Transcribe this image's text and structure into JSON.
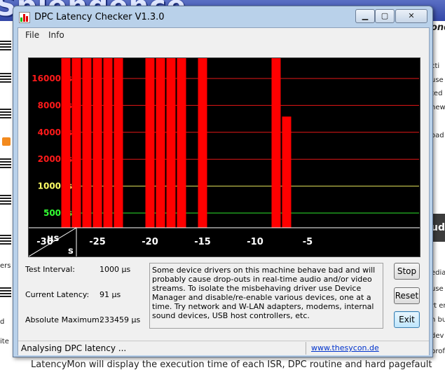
{
  "background": {
    "banner_text": "Splendence",
    "left_fragments": [
      "ers",
      "d",
      "ite"
    ],
    "right_fragments": [
      "ond",
      "cti",
      "use",
      "ted",
      "new",
      "oad",
      "udi",
      "edia",
      "use",
      "rt en",
      "n bui",
      "dev",
      "profe"
    ],
    "bottom_text": "LatencyMon will display the execution time of each ISR, DPC routine and hard pagefault"
  },
  "window": {
    "title": "DPC Latency Checker V1.3.0",
    "minimize_glyph": "▁",
    "maximize_glyph": "▢",
    "close_glyph": "✕"
  },
  "menu": {
    "items": [
      "File",
      "Info"
    ]
  },
  "chart_data": {
    "type": "bar",
    "title": "",
    "xlabel": "s",
    "ylabel": "µs",
    "x_ticks": [
      "-30",
      "-25",
      "-20",
      "-15",
      "-10",
      "-5"
    ],
    "y_ticks": [
      {
        "label": "16000µs",
        "value": 16000,
        "color": "#ff1a1a"
      },
      {
        "label": "8000µs",
        "value": 8000,
        "color": "#ff1a1a"
      },
      {
        "label": "4000µs",
        "value": 4000,
        "color": "#ff1a1a"
      },
      {
        "label": "2000µs",
        "value": 2000,
        "color": "#ff1a1a"
      },
      {
        "label": "1000µs",
        "value": 1000,
        "color": "#ffff66"
      },
      {
        "label": "500µs",
        "value": 500,
        "color": "#33ff33"
      }
    ],
    "x": [
      -33,
      -32,
      -31,
      -30,
      -29,
      -28,
      -27,
      -26,
      -25,
      -24,
      -23,
      -22,
      -21,
      -20,
      -19,
      -18,
      -17,
      -16,
      -15,
      -14,
      -13,
      -12,
      -11,
      -10,
      -9,
      -8,
      -7,
      -6,
      -5,
      -4,
      -3,
      -2,
      -1,
      0
    ],
    "values": [
      95,
      130,
      140,
      105,
      150,
      233459,
      233459,
      233459,
      233459,
      233459,
      233459,
      80,
      110,
      233459,
      233459,
      233459,
      233459,
      140,
      233459,
      150,
      145,
      140,
      130,
      125,
      150,
      233459,
      6000,
      100,
      85,
      110,
      100,
      115,
      120,
      140
    ],
    "ylim": [
      0,
      32000
    ],
    "colors": {
      "low": "#00ff00",
      "high": "#ff0000"
    }
  },
  "stats": {
    "test_interval_label": "Test Interval:",
    "test_interval_value": "1000 µs",
    "current_latency_label": "Current Latency:",
    "current_latency_value": "91 µs",
    "absolute_maximum_label": "Absolute Maximum:",
    "absolute_maximum_value": "233459 µs"
  },
  "description": "Some device drivers on this machine behave bad and will probably cause drop-outs in real-time audio and/or video streams. To isolate the misbehaving driver use Device Manager and disable/re-enable various devices, one at a time. Try network and W-LAN adapters, modems, internal sound devices, USB host controllers, etc.",
  "buttons": {
    "stop": "Stop",
    "reset": "Reset",
    "exit": "Exit"
  },
  "status": {
    "text": "Analysing DPC latency ...",
    "link": "www.thesycon.de"
  }
}
